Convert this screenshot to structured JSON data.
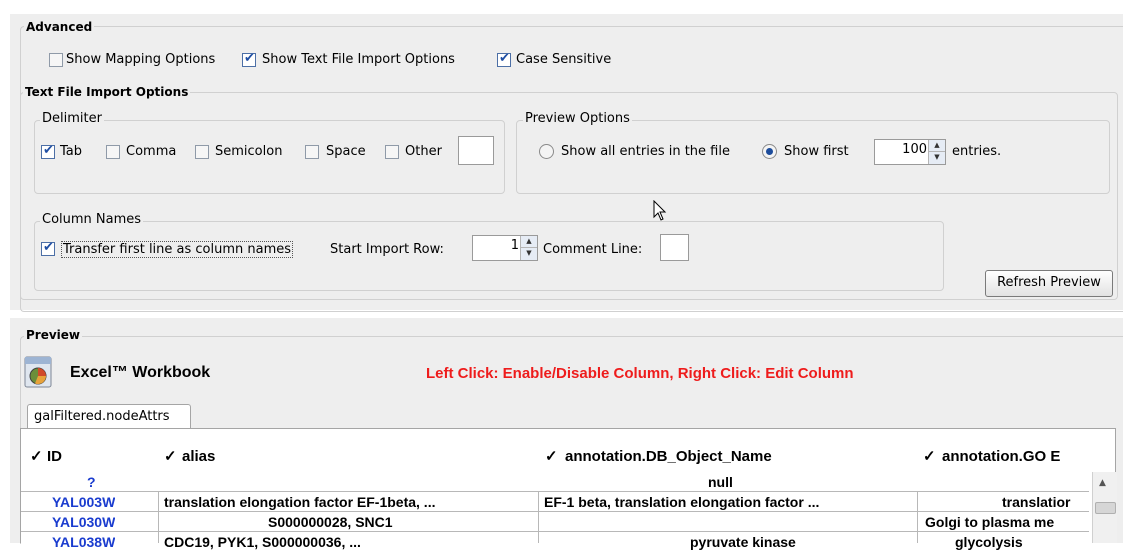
{
  "advanced": {
    "title": "Advanced",
    "show_mapping_options": {
      "label": "Show Mapping Options",
      "checked": false
    },
    "show_text_file_import_options": {
      "label": "Show Text File Import Options",
      "checked": true
    },
    "case_sensitive": {
      "label": "Case Sensitive",
      "checked": true
    }
  },
  "text_file_import_options": {
    "title": "Text File Import Options",
    "delimiter": {
      "title": "Delimiter",
      "tab": "Tab",
      "comma": "Comma",
      "semicolon": "Semicolon",
      "space": "Space",
      "other": "Other",
      "other_value": ""
    },
    "preview_options": {
      "title": "Preview Options",
      "show_all": "Show all entries in the file",
      "show_first": "Show first",
      "count": "100",
      "entries": "entries."
    },
    "column_names": {
      "title": "Column Names",
      "transfer_first_line": "Transfer first line as column names",
      "start_import_row_label": "Start Import Row:",
      "start_import_row": "1",
      "comment_line_label": "Comment Line:",
      "comment_line_value": ""
    },
    "refresh_button": "Refresh Preview"
  },
  "preview": {
    "title": "Preview",
    "workbook_label": "Excel™ Workbook",
    "instructions": "Left Click: Enable/Disable Column, Right Click: Edit Column",
    "tab": "galFiltered.nodeAttrs",
    "headers": [
      "ID",
      "alias",
      "annotation.DB_Object_Name",
      "annotation.GO E"
    ],
    "type_row": [
      "?",
      "",
      "null",
      ""
    ],
    "rows": [
      [
        "YAL003W",
        "translation elongation factor EF-1beta, ...",
        "EF-1 beta, translation elongation factor ...",
        "translatior"
      ],
      [
        "YAL030W",
        "S000000028, SNC1",
        "",
        "Golgi to plasma me"
      ],
      [
        "YAL038W",
        "CDC19, PYK1, S000000036, ...",
        "pyruvate kinase",
        "glycolysis"
      ]
    ]
  },
  "colors": {
    "instruction_red": "#ee1c1c",
    "id_blue": "#1a3ccf",
    "check_blue": "#1f4ea3"
  }
}
